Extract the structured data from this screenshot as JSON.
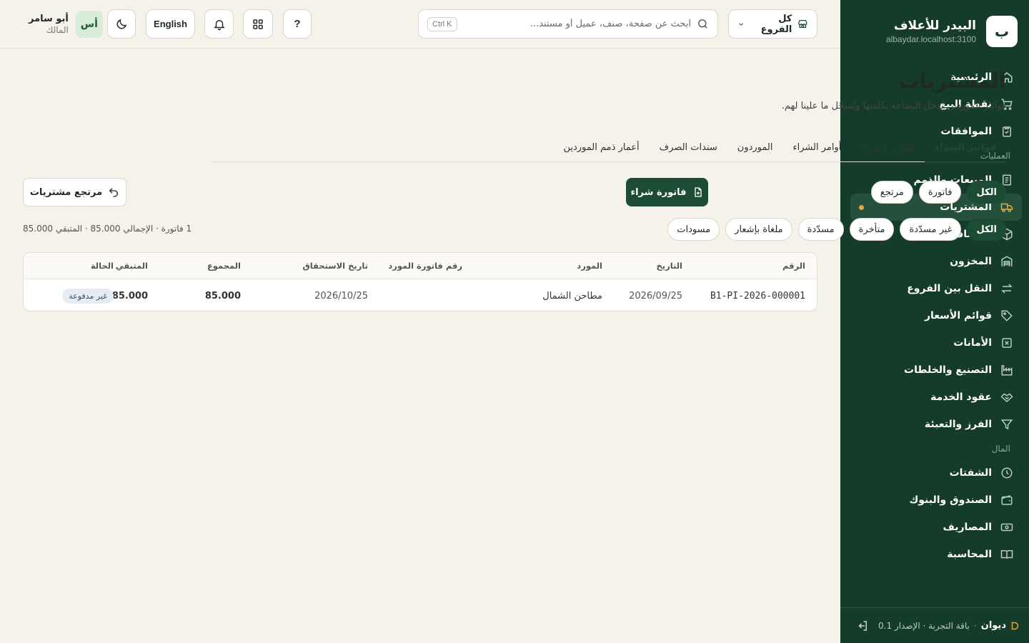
{
  "sidebar": {
    "brand_initial": "ب",
    "brand_name": "البيدر للأعلاف",
    "brand_host": "albaydar.localhost:3100",
    "items_top": [
      {
        "label": "الرئيسية",
        "icon": "home-icon"
      },
      {
        "label": "نقطة البيع",
        "icon": "cart-icon"
      },
      {
        "label": "الموافقات",
        "icon": "clipboard-check-icon"
      }
    ],
    "section_operations": "العمليات",
    "items_ops": [
      {
        "label": "المبيعات والذمم",
        "icon": "receipt-icon"
      },
      {
        "label": "المشتريات",
        "icon": "truck-icon",
        "active": true
      },
      {
        "label": "الأصناف",
        "icon": "box-icon"
      },
      {
        "label": "المخزون",
        "icon": "warehouse-icon"
      },
      {
        "label": "النقل بين الفروع",
        "icon": "transfer-icon"
      },
      {
        "label": "قوائم الأسعار",
        "icon": "tag-icon"
      },
      {
        "label": "الأمانات",
        "icon": "x-box-icon"
      },
      {
        "label": "التصنيع والخلطات",
        "icon": "factory-icon"
      },
      {
        "label": "عقود الخدمة",
        "icon": "handshake-icon"
      },
      {
        "label": "الفرز والتعبئة",
        "icon": "filter-icon"
      }
    ],
    "section_finance": "المال",
    "items_fin": [
      {
        "label": "الشفتات",
        "icon": "clock-icon"
      },
      {
        "label": "الصندوق والبنوك",
        "icon": "wallet-icon"
      },
      {
        "label": "المصاريف",
        "icon": "banknote-icon"
      },
      {
        "label": "المحاسبة",
        "icon": "book-icon"
      }
    ],
    "footer_name": "ديوان",
    "footer_sep": "·",
    "footer_plan": "باقة التجربة · الإصدار 0.1"
  },
  "topbar": {
    "branch_label": "كل الفروع",
    "search_placeholder": "ابحث عن صفحة، صنف، عميل أو مستند...",
    "search_shortcut": "Ctrl K",
    "help_label": "?",
    "lang_label": "English",
    "user_name": "أبو سامر",
    "user_role": "المالك",
    "user_initials": "أس"
  },
  "page": {
    "title": "المشتريات",
    "subtitle": "فواتير الموردين تُدخل البضاعة بكلفتها وتُسجّل ما علينا لهم.",
    "tabs": [
      "فواتير الشراء",
      "طلبات الشراء",
      "أوامر الشراء",
      "الموردون",
      "سندات الصرف",
      "أعمار ذمم الموردين"
    ],
    "type_filters": [
      "الكل",
      "فاتورة",
      "مرتجع"
    ],
    "status_filters": [
      "الكل",
      "غير مسدّدة",
      "متأخرة",
      "مسدّدة",
      "ملغاة بإشعار",
      "مسودات"
    ],
    "new_invoice_label": "فاتورة شراء",
    "return_label": "مرتجع مشتريات",
    "summary": "1 فاتورة · الإجمالي 85.000 · المتبقي 85.000"
  },
  "table": {
    "columns": [
      "الرقم",
      "التاريخ",
      "المورد",
      "رقم فاتورة المورد",
      "تاريخ الاستحقاق",
      "المجموع",
      "المتبقي",
      "الحالة"
    ],
    "rows": [
      {
        "number": "B1-PI-2026-000001",
        "date": "2026/09/25",
        "vendor": "مطاحن الشمال",
        "vendor_ref": "",
        "due": "2026/10/25",
        "total": "85.000",
        "remaining": "85.000",
        "status": "غير مدفوعة"
      }
    ]
  },
  "colors": {
    "sidebar_bg": "#153b2a",
    "accent": "#1c4c33",
    "page_bg": "#f5f2ea",
    "active_dot": "#e3a93a"
  }
}
